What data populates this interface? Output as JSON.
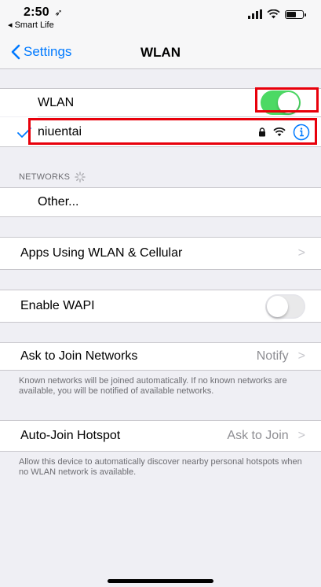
{
  "status_bar": {
    "time": "2:50",
    "time_icon": "location-arrow-icon",
    "back_app": "◂ Smart Life",
    "icons": [
      "cellular-signal-icon",
      "wifi-icon",
      "battery-icon"
    ]
  },
  "nav": {
    "back_label": "Settings",
    "title": "WLAN"
  },
  "wlan_row": {
    "label": "WLAN",
    "toggle_on": true,
    "toggle_color": "#4cd964"
  },
  "connected_network": {
    "name": "niuentai",
    "icons": [
      "checkmark-icon",
      "lock-icon",
      "wifi-icon",
      "info-icon"
    ],
    "accent": "#007aff"
  },
  "networks_section": {
    "header": "NETWORKS",
    "other_label": "Other..."
  },
  "apps_using": {
    "label": "Apps Using WLAN & Cellular"
  },
  "enable_wapi": {
    "label": "Enable WAPI",
    "toggle_on": false
  },
  "ask_to_join": {
    "label": "Ask to Join Networks",
    "value": "Notify",
    "footnote": "Known networks will be joined automatically. If no known networks are available, you will be notified of available networks."
  },
  "auto_join": {
    "label": "Auto-Join Hotspot",
    "value": "Ask to Join",
    "footnote": "Allow this device to automatically discover nearby personal hotspots when no WLAN network is available."
  },
  "highlight_color": "#e8000b"
}
